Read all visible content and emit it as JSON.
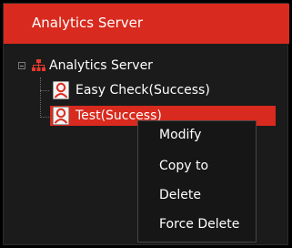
{
  "panel": {
    "title": "Analytics Server"
  },
  "tree": {
    "root": {
      "label": "Analytics Server",
      "icon": "network-icon",
      "expander_icon": "collapse-minus-icon"
    },
    "items": [
      {
        "label": "Easy Check(Success)",
        "icon": "person-icon",
        "selected": false
      },
      {
        "label": "Test(Success)",
        "icon": "person-icon",
        "selected": true
      }
    ]
  },
  "context_menu": {
    "items": [
      {
        "label": "Modify"
      },
      {
        "label": "Copy to"
      },
      {
        "label": "Delete"
      },
      {
        "label": "Force Delete"
      }
    ]
  },
  "colors": {
    "accent": "#d82a1e",
    "panel_bg": "#1b1b1b",
    "menu_bg": "#161616",
    "text": "#ffffff"
  }
}
